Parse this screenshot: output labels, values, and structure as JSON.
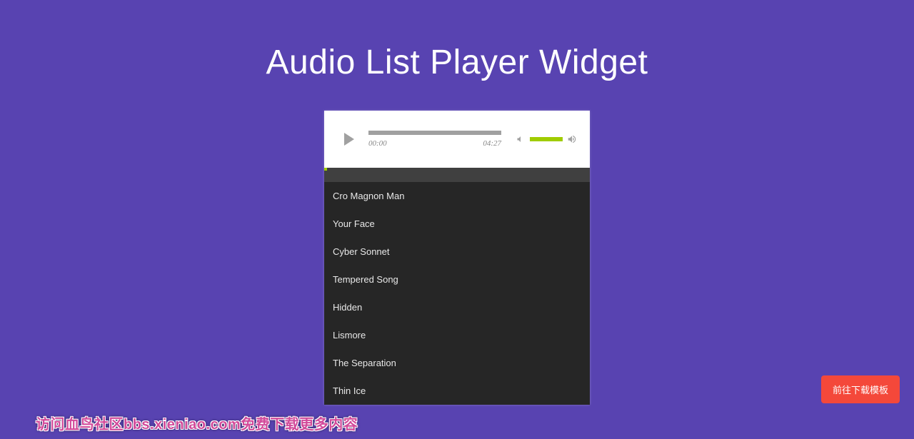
{
  "title": "Audio List Player Widget",
  "player": {
    "current_time": "00:00",
    "duration": "04:27"
  },
  "playlist": [
    {
      "title": "Cro Magnon Man"
    },
    {
      "title": "Your Face"
    },
    {
      "title": "Cyber Sonnet"
    },
    {
      "title": "Tempered Song"
    },
    {
      "title": "Hidden"
    },
    {
      "title": "Lismore"
    },
    {
      "title": "The Separation"
    },
    {
      "title": "Thin Ice"
    }
  ],
  "download_button": "前往下载模板",
  "watermark": "访问血鸟社区bbs.xieniao.com免费下载更多内容"
}
